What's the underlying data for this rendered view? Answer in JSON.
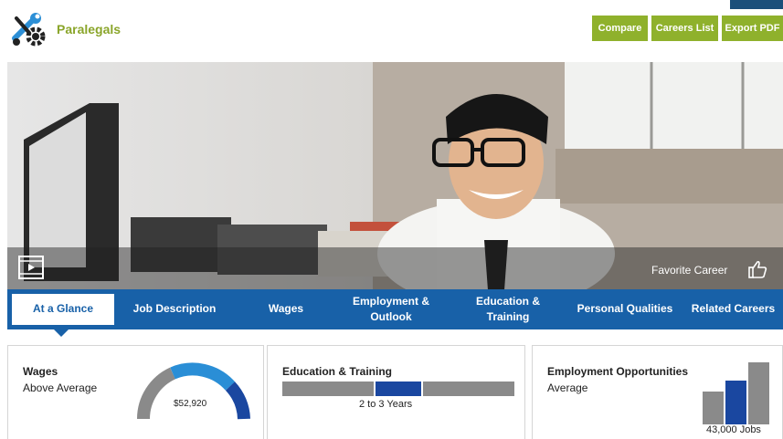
{
  "header": {
    "career_title": "Paralegals",
    "buttons": {
      "compare": "Compare",
      "careers_list": "Careers List",
      "export_pdf": "Export PDF"
    }
  },
  "hero": {
    "favorite_label": "Favorite Career"
  },
  "tabs": [
    {
      "label": "At a Glance",
      "active": true
    },
    {
      "label": "Job Description"
    },
    {
      "label": "Wages"
    },
    {
      "label": "Employment & Outlook"
    },
    {
      "label": "Education & Training"
    },
    {
      "label": "Personal Qualities"
    },
    {
      "label": "Related Careers"
    }
  ],
  "cards": {
    "wages": {
      "title": "Wages",
      "rating": "Above Average",
      "value": "$52,920"
    },
    "education": {
      "title": "Education & Training",
      "caption": "2 to 3 Years",
      "highlight_segment": 2,
      "segments": 5
    },
    "employment": {
      "title": "Employment Opportunities",
      "rating": "Average",
      "caption": "43,000 Jobs",
      "highlight_bar": 2
    }
  },
  "colors": {
    "brand_green": "#8fb12c",
    "nav_blue": "#1861a8",
    "bar_blue": "#1a47a0",
    "bar_gray": "#8a8a8a"
  }
}
